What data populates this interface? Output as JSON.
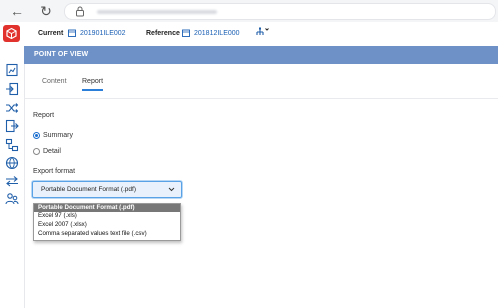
{
  "browser": {
    "back_icon": "arrow-left-icon",
    "reload_icon": "reload-icon",
    "lock_icon": "lock-icon"
  },
  "header": {
    "current_label": "Current",
    "current_value": "201901ILE002",
    "reference_label": "Reference",
    "reference_value": "201812ILE000",
    "calendar_icon": "calendar-icon",
    "tree_icon": "hierarchy-icon"
  },
  "sidebar": {
    "icons": [
      "report-icon",
      "import-icon",
      "shuffle-icon",
      "export-icon",
      "flow-icon",
      "globe-icon",
      "swap-icon",
      "people-icon"
    ],
    "accent": "#e1322d"
  },
  "panel": {
    "title": "POINT OF VIEW",
    "tabs": [
      {
        "label": "Content"
      },
      {
        "label": "Report"
      }
    ]
  },
  "report": {
    "label": "Report",
    "options": [
      {
        "label": "Summary",
        "checked": true
      },
      {
        "label": "Detail",
        "checked": false
      }
    ]
  },
  "export": {
    "label": "Export format",
    "selected": "Portable Document Format (.pdf)",
    "options": [
      "Portable Document Format (.pdf)",
      "Excel 97 (.xls)",
      "Excel 2007 (.xlsx)",
      "Comma separated values text file (.csv)"
    ]
  },
  "colors": {
    "header_bar": "#6e92c8",
    "link_blue": "#1a5fb4",
    "tab_accent": "#2b7fd9"
  }
}
